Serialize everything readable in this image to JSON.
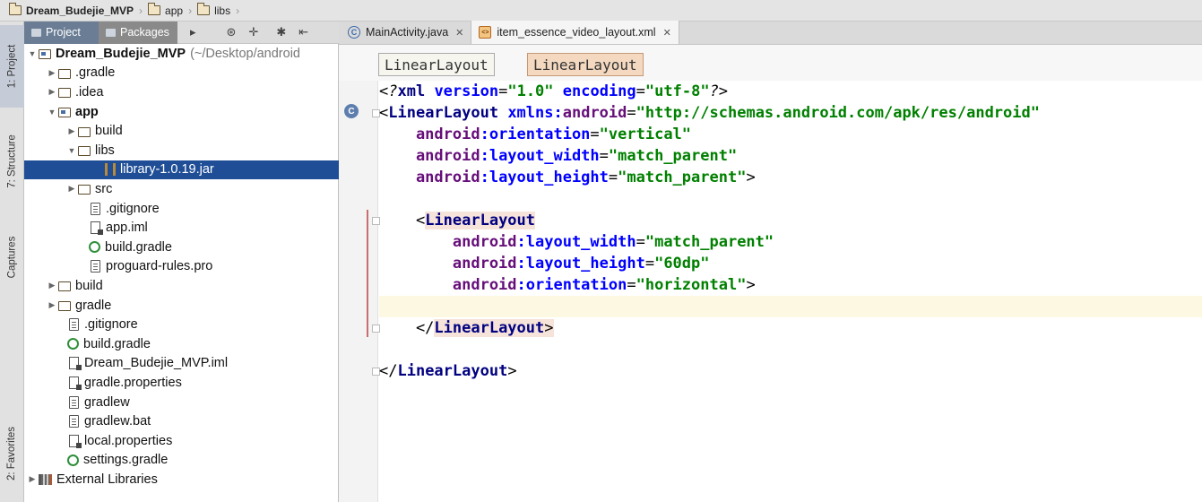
{
  "breadcrumb": [
    {
      "label": "Dream_Budejie_MVP"
    },
    {
      "label": "app"
    },
    {
      "label": "libs"
    }
  ],
  "toolstrip": {
    "project": "1: Project",
    "structure": "7: Structure",
    "captures": "Captures",
    "favorites": "2: Favorites"
  },
  "panel": {
    "project_tab": "Project",
    "packages_tab": "Packages"
  },
  "tree": {
    "root_name": "Dream_Budejie_MVP",
    "root_path": "(~/Desktop/android",
    "items": [
      {
        "label": ".gradle"
      },
      {
        "label": ".idea"
      },
      {
        "label": "app"
      },
      {
        "label": "build"
      },
      {
        "label": "libs"
      },
      {
        "label": "library-1.0.19.jar"
      },
      {
        "label": "src"
      },
      {
        "label": ".gitignore"
      },
      {
        "label": "app.iml"
      },
      {
        "label": "build.gradle"
      },
      {
        "label": "proguard-rules.pro"
      },
      {
        "label": "build"
      },
      {
        "label": "gradle"
      },
      {
        "label": ".gitignore"
      },
      {
        "label": "build.gradle"
      },
      {
        "label": "Dream_Budejie_MVP.iml"
      },
      {
        "label": "gradle.properties"
      },
      {
        "label": "gradlew"
      },
      {
        "label": "gradlew.bat"
      },
      {
        "label": "local.properties"
      },
      {
        "label": "settings.gradle"
      },
      {
        "label": "External Libraries"
      }
    ]
  },
  "editor_tabs": [
    {
      "label": "MainActivity.java"
    },
    {
      "label": "item_essence_video_layout.xml"
    }
  ],
  "xml_breadcrumb": [
    "LinearLayout",
    "LinearLayout"
  ],
  "code": {
    "l1": {
      "a": "<?",
      "b": "xml ",
      "c": "version",
      "d": "=",
      "e": "\"1.0\"",
      "f": " encoding",
      "g": "=",
      "h": "\"utf-8\"",
      "i": "?>"
    },
    "l2": {
      "a": "<",
      "b": "LinearLayout ",
      "c": "xmlns:",
      "d": "android",
      "e": "=",
      "f": "\"http://schemas.android.com/apk/res/android\""
    },
    "l3": {
      "a": "    android",
      "b": ":orientation",
      "c": "=",
      "d": "\"vertical\""
    },
    "l4": {
      "a": "    android",
      "b": ":layout_width",
      "c": "=",
      "d": "\"match_parent\""
    },
    "l5": {
      "a": "    android",
      "b": ":layout_height",
      "c": "=",
      "d": "\"match_parent\"",
      "e": ">"
    },
    "l7": {
      "a": "    <",
      "b": "LinearLayout"
    },
    "l8": {
      "a": "        android",
      "b": ":layout_width",
      "c": "=",
      "d": "\"match_parent\""
    },
    "l9": {
      "a": "        android",
      "b": ":layout_height",
      "c": "=",
      "d": "\"60dp\""
    },
    "l10": {
      "a": "        android",
      "b": ":orientation",
      "c": "=",
      "d": "\"horizontal\"",
      "e": ">"
    },
    "l12": {
      "a": "    </",
      "b": "LinearLayout",
      "c": ">"
    },
    "l14": {
      "a": "</",
      "b": "LinearLayout",
      "c": ">"
    }
  }
}
